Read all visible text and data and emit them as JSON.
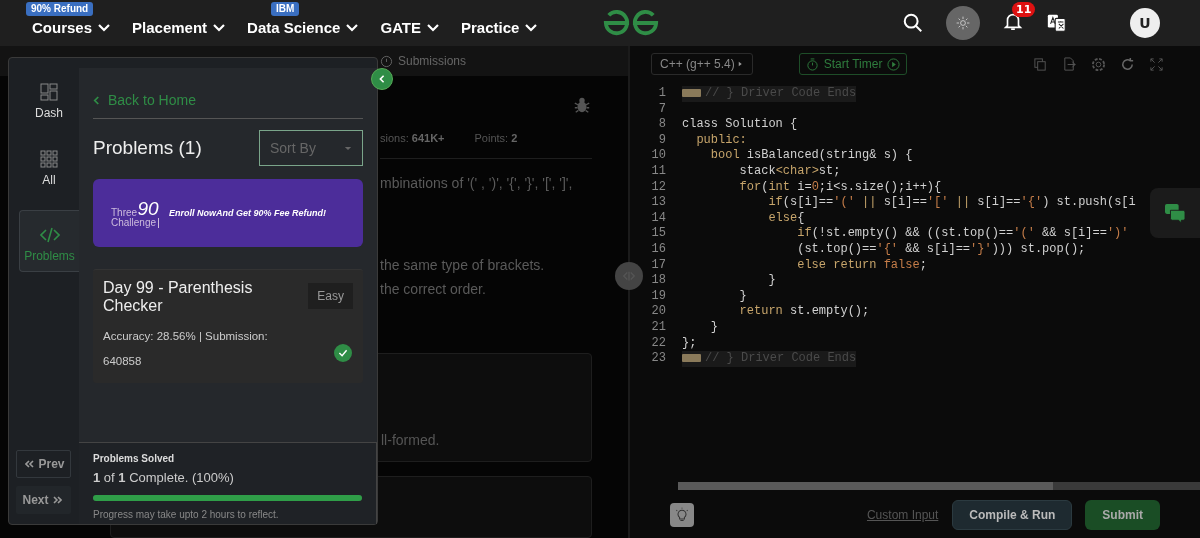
{
  "nav": {
    "items": [
      {
        "label": "Courses",
        "badge": "90% Refund"
      },
      {
        "label": "Placement"
      },
      {
        "label": "Data Science",
        "badge": "IBM"
      },
      {
        "label": "GATE"
      },
      {
        "label": "Practice"
      }
    ],
    "notifications": "11",
    "avatar": "U"
  },
  "problem_pane": {
    "tab": "Submissions",
    "stats": [
      {
        "label": "sions:",
        "value": "641K+"
      },
      {
        "label": "Points:",
        "value": "2"
      }
    ],
    "lines": [
      "mbinations of '(' , ')', '{', '}', '[', ']',",
      "the same type of brackets.",
      "the correct order."
    ],
    "example_line": "ll-formed."
  },
  "panel": {
    "rail": [
      {
        "label": "Dash",
        "selected": false
      },
      {
        "label": "All",
        "selected": false
      },
      {
        "label": "Problems",
        "selected": true
      }
    ],
    "prev": "Prev",
    "next": "Next",
    "back": "Back to Home",
    "heading": "Problems (1)",
    "sort": {
      "placeholder": "Sort By"
    },
    "banner": {
      "logo_word": "Three",
      "logo_number": "90",
      "logo_tail": "Challenge",
      "text": "Enroll NowAnd Get 90% Fee Refund!"
    },
    "problem": {
      "title": "Day 99 - Parenthesis Checker",
      "difficulty": "Easy",
      "stats": "Accuracy: 28.56% | Submission: 640858",
      "solved": true
    },
    "progress": {
      "title": "Problems Solved",
      "summary": "**1** of **1** Complete. (100%)",
      "level": 1,
      "note": "Progress may take upto 2 hours to reflect."
    }
  },
  "editor": {
    "language": "C++ (g++ 5.4)",
    "timer": "Start Timer",
    "lines": [
      {
        "num": "1",
        "kind": "fold",
        "segments": [
          {
            "text": "// } Driver Code Ends",
            "kind": "comment"
          }
        ]
      },
      {
        "num": "7",
        "kind": "code"
      },
      {
        "num": "8",
        "kind": "code",
        "segments": [
          {
            "text": "class Solution {",
            "kind": "plain"
          }
        ]
      },
      {
        "num": "9",
        "kind": "code",
        "segments": [
          {
            "text": "  public:",
            "kind": "keyword"
          }
        ]
      },
      {
        "num": "10",
        "kind": "code",
        "segments": [
          {
            "text": "    bool",
            "kind": "keyword"
          },
          {
            "text": " isBalanced(string& s) {",
            "kind": "plain"
          }
        ]
      },
      {
        "num": "11",
        "kind": "code",
        "segments": [
          {
            "text": "        stack",
            "kind": "plain"
          },
          {
            "text": "<char>",
            "kind": "keyword"
          },
          {
            "text": "st;",
            "kind": "plain"
          }
        ]
      },
      {
        "num": "12",
        "kind": "code",
        "segments": [
          {
            "text": "        for",
            "kind": "keyword"
          },
          {
            "text": "(",
            "kind": "plain"
          },
          {
            "text": "int",
            "kind": "keyword"
          },
          {
            "text": " i=",
            "kind": "plain"
          },
          {
            "text": "0",
            "kind": "literal"
          },
          {
            "text": ";i<s.size();i++){",
            "kind": "plain"
          }
        ]
      },
      {
        "num": "13",
        "kind": "code",
        "segments": [
          {
            "text": "            if",
            "kind": "keyword"
          },
          {
            "text": "(s[i]==",
            "kind": "plain"
          },
          {
            "text": "'('",
            "kind": "literal"
          },
          {
            "text": " || ",
            "kind": "keyword"
          },
          {
            "text": "s[i]==",
            "kind": "plain"
          },
          {
            "text": "'['",
            "kind": "literal"
          },
          {
            "text": " || ",
            "kind": "keyword"
          },
          {
            "text": "s[i]==",
            "kind": "plain"
          },
          {
            "text": "'{'",
            "kind": "literal"
          },
          {
            "text": ") st.push(s[i",
            "kind": "plain"
          }
        ]
      },
      {
        "num": "14",
        "kind": "code",
        "segments": [
          {
            "text": "            else",
            "kind": "keyword"
          },
          {
            "text": "{",
            "kind": "plain"
          }
        ]
      },
      {
        "num": "15",
        "kind": "code",
        "segments": [
          {
            "text": "                if",
            "kind": "keyword"
          },
          {
            "text": "(!st.empty() && ((st.top()==",
            "kind": "plain"
          },
          {
            "text": "'('",
            "kind": "literal"
          },
          {
            "text": " && s[i]==",
            "kind": "plain"
          },
          {
            "text": "')'",
            "kind": "literal"
          }
        ]
      },
      {
        "num": "16",
        "kind": "code",
        "segments": [
          {
            "text": "                (st.top()==",
            "kind": "plain"
          },
          {
            "text": "'{'",
            "kind": "literal"
          },
          {
            "text": " && s[i]==",
            "kind": "plain"
          },
          {
            "text": "'}'",
            "kind": "literal"
          },
          {
            "text": "))) st.pop();",
            "kind": "plain"
          }
        ]
      },
      {
        "num": "17",
        "kind": "code",
        "segments": [
          {
            "text": "                else return ",
            "kind": "keyword"
          },
          {
            "text": "false",
            "kind": "literal"
          },
          {
            "text": ";",
            "kind": "plain"
          }
        ]
      },
      {
        "num": "18",
        "kind": "code",
        "segments": [
          {
            "text": "            }",
            "kind": "plain"
          }
        ]
      },
      {
        "num": "19",
        "kind": "code",
        "segments": [
          {
            "text": "        }",
            "kind": "plain"
          }
        ]
      },
      {
        "num": "20",
        "kind": "code",
        "segments": [
          {
            "text": "        return",
            "kind": "keyword"
          },
          {
            "text": " st.empty();",
            "kind": "plain"
          }
        ]
      },
      {
        "num": "21",
        "kind": "code",
        "segments": [
          {
            "text": "    }",
            "kind": "plain"
          }
        ]
      },
      {
        "num": "22",
        "kind": "code",
        "segments": [
          {
            "text": "};",
            "kind": "plain"
          }
        ]
      },
      {
        "num": "23",
        "kind": "fold",
        "segments": [
          {
            "text": "// } Driver Code Ends",
            "kind": "comment"
          }
        ]
      }
    ],
    "custom_input": "Custom Input",
    "compile": "Compile & Run",
    "submit": "Submit"
  }
}
